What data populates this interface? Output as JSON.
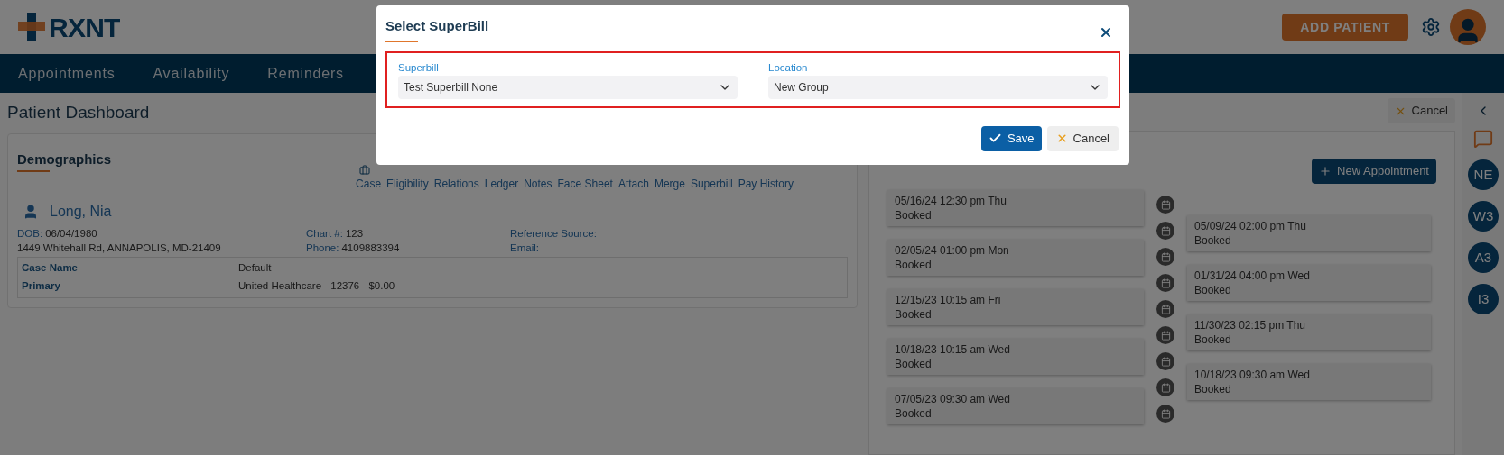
{
  "header": {
    "logo": "RXNT",
    "add_patient": "ADD PATIENT"
  },
  "nav": [
    {
      "label": "Appointments",
      "selected": false
    },
    {
      "label": "Availability",
      "selected": false
    },
    {
      "label": "Reminders",
      "selected": false
    }
  ],
  "page_title": "Patient Dashboard",
  "demographics": {
    "title": "Demographics",
    "links": [
      "Case",
      "Eligibility",
      "Relations",
      "Ledger",
      "Notes",
      "Face Sheet",
      "Attach",
      "Merge",
      "Superbill",
      "Pay History"
    ],
    "patient_name": "Long, Nia",
    "fields": [
      {
        "label": "DOB:",
        "value": "06/04/1980"
      },
      {
        "label": "Chart #:",
        "value": "123"
      },
      {
        "label": "Reference Source:"
      },
      {
        "value": "1449 Whitehall Rd, ANNAPOLIS, MD-21409"
      },
      {
        "label": "Phone:",
        "value": "4109883394"
      },
      {
        "label": "Email:"
      }
    ],
    "case_rows": [
      {
        "label": "Case Name",
        "value": "Default"
      },
      {
        "label": "Primary",
        "value": "United Healthcare - 12376 - $0.00"
      }
    ]
  },
  "appointments": {
    "cancel": "Cancel",
    "new_appointment": "New Appointment",
    "left": [
      {
        "when": "05/16/24 12:30 pm Thu",
        "status": "Booked"
      },
      {
        "when": "02/05/24 01:00 pm Mon",
        "status": "Booked"
      },
      {
        "when": "12/15/23 10:15 am Fri",
        "status": "Booked"
      },
      {
        "when": "10/18/23 10:15 am Wed",
        "status": "Booked"
      },
      {
        "when": "07/05/23 09:30 am Wed",
        "status": "Booked"
      }
    ],
    "right": [
      {
        "when": "05/09/24 02:00 pm Thu",
        "status": "Booked"
      },
      {
        "when": "01/31/24 04:00 pm Wed",
        "status": "Booked"
      },
      {
        "when": "11/30/23 02:15 pm Thu",
        "status": "Booked"
      },
      {
        "when": "10/18/23 09:30 am Wed",
        "status": "Booked"
      }
    ]
  },
  "rail": {
    "users": [
      "NE",
      "W3",
      "A3",
      "I3"
    ]
  },
  "modal": {
    "title": "Select SuperBill",
    "fields": [
      {
        "label": "Superbill",
        "value": "Test Superbill None"
      },
      {
        "label": "Location",
        "value": "New Group"
      }
    ],
    "save": "Save",
    "cancel": "Cancel"
  }
}
